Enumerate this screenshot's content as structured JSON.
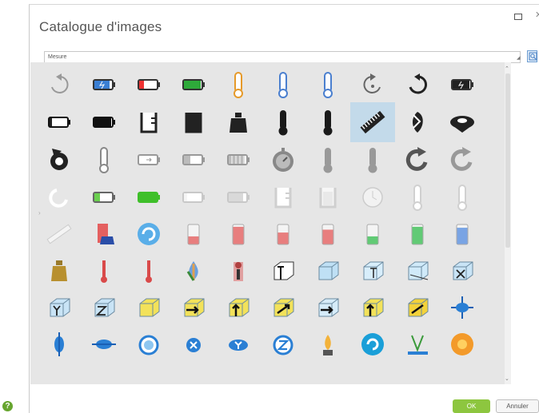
{
  "window": {
    "title": "Catalogue d'images"
  },
  "category": {
    "value": "Mesure"
  },
  "buttons": {
    "ok": "OK",
    "cancel": "Annuler",
    "help": "?"
  },
  "selected": "ruler-icon",
  "icons": [
    [
      "rotate-ccw-icon",
      "battery-charging-icon",
      "battery-low-icon",
      "battery-full-icon",
      "thermometer-orange-icon",
      "thermometer-blue-icon",
      "thermometer-blue-icon",
      "rotate-cw-dashed-icon",
      "rotate-ccw-black-icon",
      "battery-charging-black-icon"
    ],
    [
      "battery-empty-black-icon",
      "battery-full-black-icon",
      "beaker-empty-black-icon",
      "beaker-full-black-icon",
      "weight-black-icon",
      "thermometer-black-icon",
      "thermometer-black-icon",
      "ruler-icon",
      "recycle-black-icon",
      "mass-disc-black-icon"
    ],
    [
      "rotate-arrow-black-icon",
      "thermometer-outline-icon",
      "battery-outline-icon",
      "battery-gray-icon",
      "battery-segments-icon",
      "stopwatch-icon",
      "thermometer-gray-icon",
      "thermometer-gray-icon",
      "rotate-cw-gray-icon",
      "rotate-cw-light-icon"
    ],
    [
      "rotate-faint-icon",
      "battery-green-outline-icon",
      "battery-green-full-icon",
      "battery-white-icon",
      "battery-white-full-icon",
      "beaker-white-empty-icon",
      "beaker-white-full-icon",
      "clock-faint-icon",
      "thermometer-faint-icon",
      "thermometer-faint-icon"
    ],
    [
      "ruler-faint-icon",
      "beaker-red-blue-icon",
      "rotation-blue-icon",
      "glass-red-low-icon",
      "glass-red-full-icon",
      "glass-red-mid-icon",
      "glass-red-small-icon",
      "glass-green-low-icon",
      "glass-green-full-icon",
      "glass-blue-icon"
    ],
    [
      "weight-gold-icon",
      "thermometer-red-icon",
      "thermometer-red-icon",
      "thermometer-drop-icon",
      "thermometer-figure-icon",
      "axis-cube-t-icon",
      "glass-cube-icon",
      "axis-cube-small-icon",
      "glass-cube-light-icon",
      "axis-cube-x-icon"
    ],
    [
      "axis-cube-y-icon",
      "axis-cube-z-icon",
      "cube-yellow-icon",
      "cube-yellow-arrow-right-icon",
      "cube-yellow-arrow-up-icon",
      "cube-yellow-arrow-diag-icon",
      "cube-glass-arrow-right-icon",
      "cube-glass-arrow-up-icon",
      "cube-yellow-flat-icon",
      "axis-rotate-blue-icon"
    ],
    [
      "rotate-vertical-blue-icon",
      "rotate-horizontal-blue-icon",
      "rotate-3d-icon",
      "rotate-x-icon",
      "rotate-y-icon",
      "rotate-z-icon",
      "lamp-icon",
      "reset-blue-icon",
      "angle-measure-icon",
      "sun-orange-icon"
    ]
  ]
}
